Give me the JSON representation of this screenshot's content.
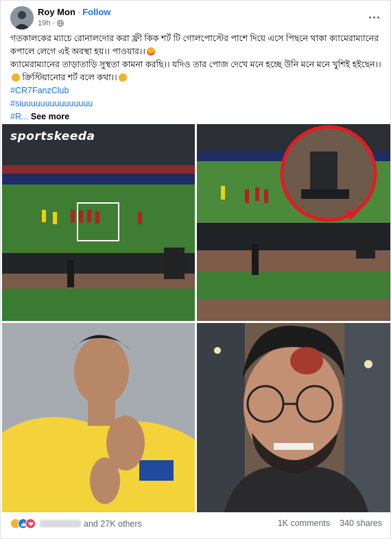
{
  "post": {
    "author": "Roy Mon",
    "separator": "·",
    "follow_label": "Follow",
    "time": "19h",
    "privacy_icon": "globe-icon",
    "more_icon": "more-dots-icon",
    "text_line1": "গতকালকের ম্যাচে রোনালদোর করা ফ্রী কিক শর্ট টি গোলপোস্টের পাশে দিয়ে এসে পিছনে থাকা ক্যামেরাম্যানের কপালে লেগে এই অবস্থা হয়।। পাওয়ার।।",
    "text_line2": "ক্যামেরাম্যানের তাড়াতাড়ি সুস্থতা কামনা করছি।। যদিও তার পোজ দেখে মনে হচ্ছে উনি মনে মনে খুশিই হইছেন।।",
    "text_line3": "ক্রিস্টিয়ানোর শর্ট বলে কথা।।",
    "hashtags": [
      "#CR7FanzClub",
      "#siuuuuuuuuuuuuuuu"
    ],
    "truncated_hashtag": "#R...",
    "see_more": "See more"
  },
  "images": {
    "watermark": "sportskeeda"
  },
  "footer": {
    "reaction_icons": [
      "sad-reaction-icon",
      "like-reaction-icon",
      "love-reaction-icon"
    ],
    "others": "and 27K others",
    "comments": "1K comments",
    "shares": "340 shares"
  },
  "colors": {
    "link": "#1b74e4",
    "follow": "#1877f2",
    "secondary_text": "#65676b"
  }
}
